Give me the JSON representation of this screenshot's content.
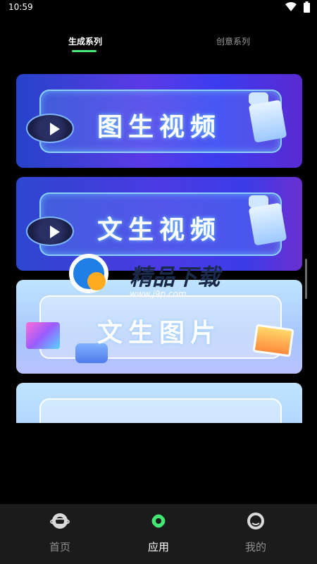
{
  "status_bar": {
    "time": "10:59"
  },
  "tabs": {
    "generate": "生成系列",
    "creative": "创意系列"
  },
  "cards": [
    {
      "title": "图生视频"
    },
    {
      "title": "文生视频"
    },
    {
      "title": "文生图片"
    },
    {
      "title": ""
    }
  ],
  "watermark": {
    "brand": "精品下载",
    "url": "www.j9p.com"
  },
  "bottom_nav": {
    "home": "首页",
    "apps": "应用",
    "me": "我的"
  },
  "colors": {
    "active_tab": "#46e86e",
    "inactive_tab": "#9a9a9a",
    "nav_bg": "#1b1b1b"
  }
}
